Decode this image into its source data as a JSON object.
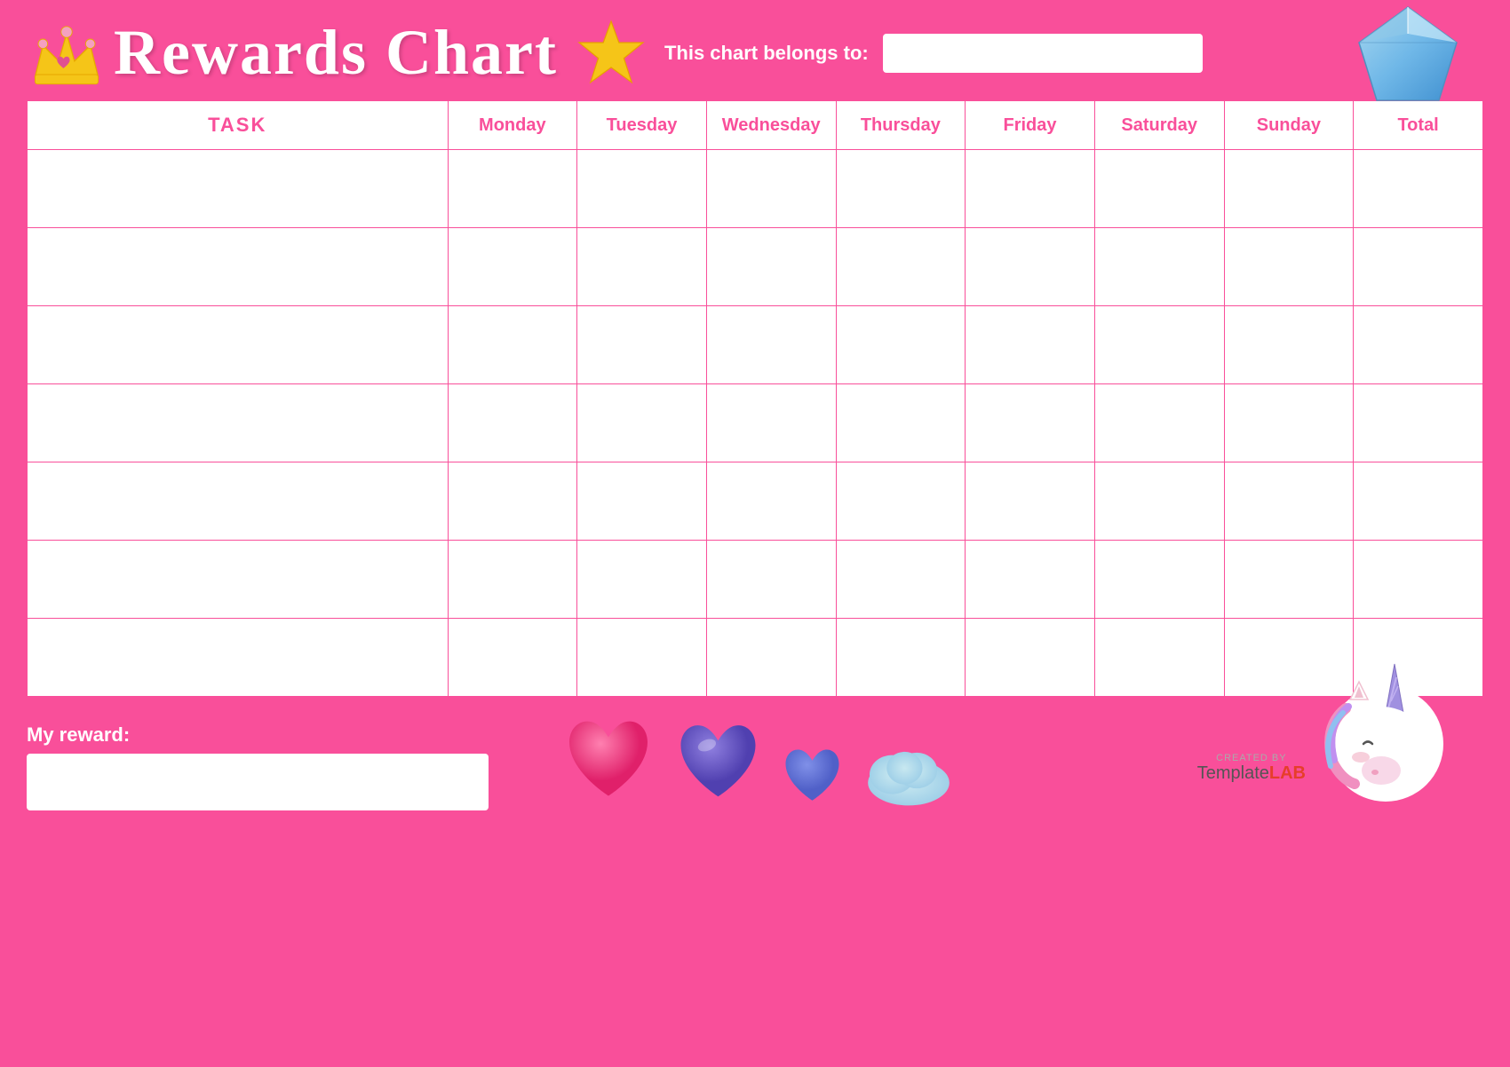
{
  "header": {
    "title": "Rewards Chart",
    "belongs_to_label": "This chart belongs to:",
    "belongs_to_placeholder": ""
  },
  "table": {
    "columns": [
      {
        "key": "task",
        "label": "TASK"
      },
      {
        "key": "monday",
        "label": "Monday"
      },
      {
        "key": "tuesday",
        "label": "Tuesday"
      },
      {
        "key": "wednesday",
        "label": "Wednesday"
      },
      {
        "key": "thursday",
        "label": "Thursday"
      },
      {
        "key": "friday",
        "label": "Friday"
      },
      {
        "key": "saturday",
        "label": "Saturday"
      },
      {
        "key": "sunday",
        "label": "Sunday"
      },
      {
        "key": "total",
        "label": "Total"
      }
    ],
    "row_count": 7
  },
  "bottom": {
    "my_reward_label": "My reward:",
    "my_reward_placeholder": ""
  },
  "branding": {
    "created_by": "CREATED BY",
    "template_text": "Template",
    "lab_text": "LAB"
  },
  "colors": {
    "background": "#f94f9a",
    "white": "#ffffff",
    "table_border": "#f94f9a",
    "header_text": "#f94f9a",
    "title_color": "#ffffff"
  }
}
